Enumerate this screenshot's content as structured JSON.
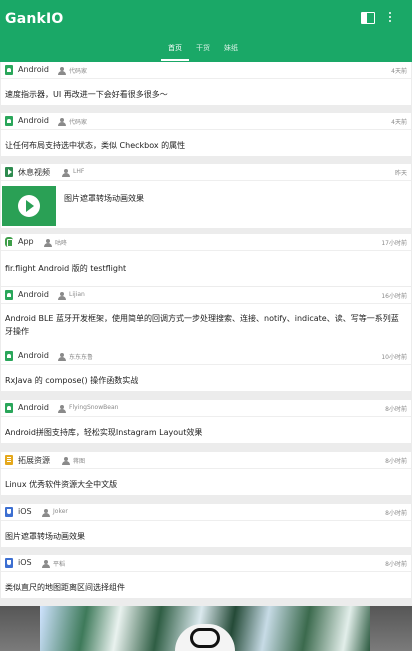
{
  "app": {
    "title": "GankIO",
    "actions": [
      {
        "name": "view-toggle-icon"
      },
      {
        "name": "more-icon"
      }
    ]
  },
  "tabs": [
    {
      "label": "首页",
      "active": true
    },
    {
      "label": "干货",
      "active": false
    },
    {
      "label": "妹纸",
      "active": false
    }
  ],
  "feed": [
    {
      "type": "Android",
      "icon": "android-icon",
      "author": "代码家",
      "time": "4天前",
      "desc": "速度指示器，UI 再改进一下会好看很多很多～"
    },
    {
      "type": "Android",
      "icon": "android-icon",
      "author": "代码家",
      "time": "4天前",
      "desc": "让任何布局支持选中状态，类似 Checkbox 的属性"
    },
    {
      "type": "休息视频",
      "icon": "video-icon",
      "author": "LHF",
      "time": "昨天",
      "desc": "图片遮罩转场动画效果",
      "has_thumbnail": true
    },
    {
      "type": "App",
      "icon": "app-icon",
      "author": "咕咚",
      "time": "17小时前",
      "desc": "fir.flight Android 版的 testflight"
    },
    {
      "type": "Android",
      "icon": "android-icon",
      "author": "Lijian",
      "time": "16小时前",
      "desc": "Android BLE 蓝牙开发框架，使用简单的回调方式一步处理搜索、连接、notify、indicate、读、写等一系列蓝牙操作"
    },
    {
      "type": "Android",
      "icon": "android-icon",
      "author": "东东东鲁",
      "time": "10小时前",
      "desc": "RxJava 的 compose() 操作函数实战"
    },
    {
      "type": "Android",
      "icon": "android-icon",
      "author": "FlyingSnowBean",
      "time": "8小时前",
      "desc": "Android拼图支持库，轻松实现Instagram Layout效果"
    },
    {
      "type": "拓展资源",
      "icon": "resource-icon",
      "author": "蒋图",
      "time": "8小时前",
      "desc": "Linux 优秀软件资源大全中文版"
    },
    {
      "type": "iOS",
      "icon": "ios-icon",
      "author": "Joker",
      "time": "8小时前",
      "desc": "图片遮罩转场动画效果"
    },
    {
      "type": "iOS",
      "icon": "ios-icon",
      "author": "平稻",
      "time": "8小时前",
      "desc": "类似直尺的地图距离区间选择组件"
    }
  ],
  "colors": {
    "primary": "#1aa867",
    "background": "#ececec",
    "card": "#ffffff"
  }
}
